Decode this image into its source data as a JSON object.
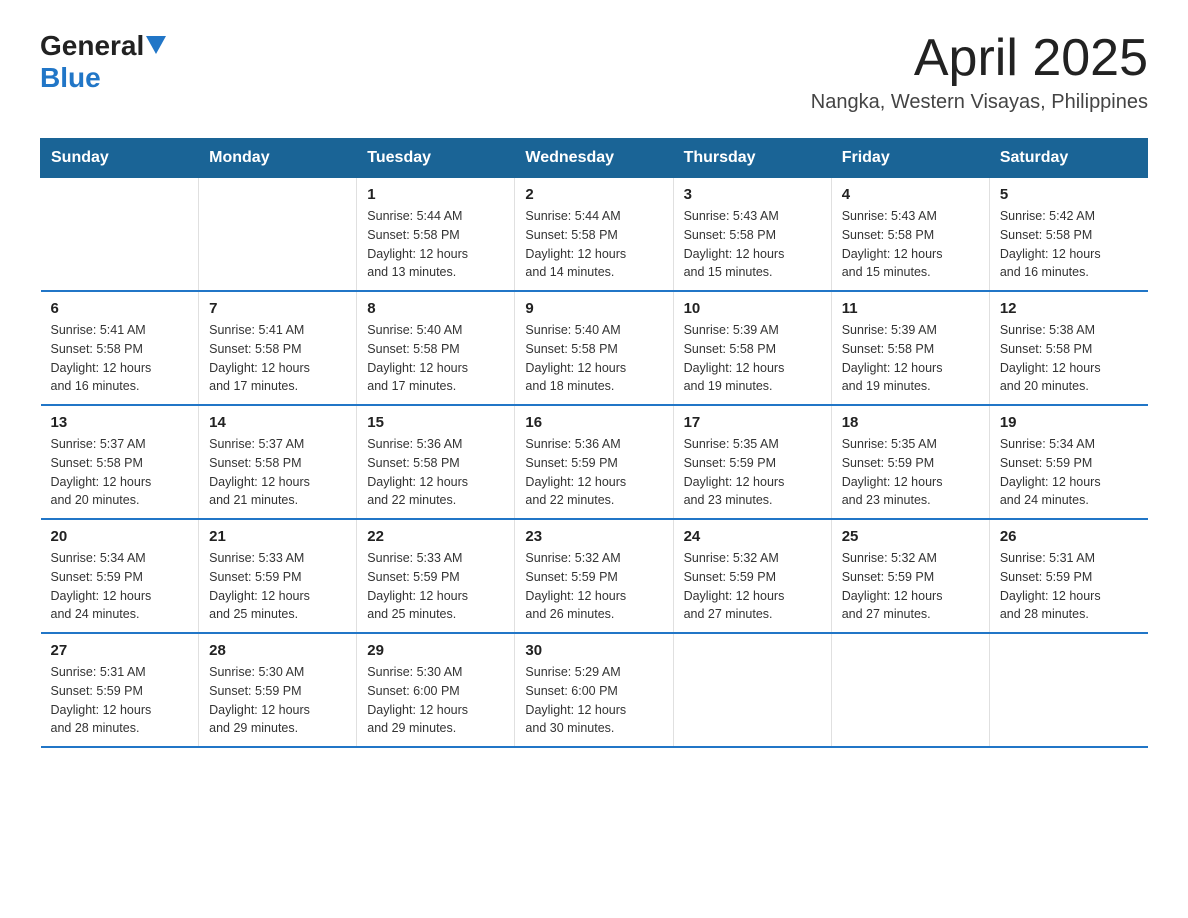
{
  "header": {
    "logo_general": "General",
    "logo_blue": "Blue",
    "month_title": "April 2025",
    "location": "Nangka, Western Visayas, Philippines"
  },
  "days_of_week": [
    "Sunday",
    "Monday",
    "Tuesday",
    "Wednesday",
    "Thursday",
    "Friday",
    "Saturday"
  ],
  "weeks": [
    [
      {
        "day": "",
        "info": ""
      },
      {
        "day": "",
        "info": ""
      },
      {
        "day": "1",
        "info": "Sunrise: 5:44 AM\nSunset: 5:58 PM\nDaylight: 12 hours\nand 13 minutes."
      },
      {
        "day": "2",
        "info": "Sunrise: 5:44 AM\nSunset: 5:58 PM\nDaylight: 12 hours\nand 14 minutes."
      },
      {
        "day": "3",
        "info": "Sunrise: 5:43 AM\nSunset: 5:58 PM\nDaylight: 12 hours\nand 15 minutes."
      },
      {
        "day": "4",
        "info": "Sunrise: 5:43 AM\nSunset: 5:58 PM\nDaylight: 12 hours\nand 15 minutes."
      },
      {
        "day": "5",
        "info": "Sunrise: 5:42 AM\nSunset: 5:58 PM\nDaylight: 12 hours\nand 16 minutes."
      }
    ],
    [
      {
        "day": "6",
        "info": "Sunrise: 5:41 AM\nSunset: 5:58 PM\nDaylight: 12 hours\nand 16 minutes."
      },
      {
        "day": "7",
        "info": "Sunrise: 5:41 AM\nSunset: 5:58 PM\nDaylight: 12 hours\nand 17 minutes."
      },
      {
        "day": "8",
        "info": "Sunrise: 5:40 AM\nSunset: 5:58 PM\nDaylight: 12 hours\nand 17 minutes."
      },
      {
        "day": "9",
        "info": "Sunrise: 5:40 AM\nSunset: 5:58 PM\nDaylight: 12 hours\nand 18 minutes."
      },
      {
        "day": "10",
        "info": "Sunrise: 5:39 AM\nSunset: 5:58 PM\nDaylight: 12 hours\nand 19 minutes."
      },
      {
        "day": "11",
        "info": "Sunrise: 5:39 AM\nSunset: 5:58 PM\nDaylight: 12 hours\nand 19 minutes."
      },
      {
        "day": "12",
        "info": "Sunrise: 5:38 AM\nSunset: 5:58 PM\nDaylight: 12 hours\nand 20 minutes."
      }
    ],
    [
      {
        "day": "13",
        "info": "Sunrise: 5:37 AM\nSunset: 5:58 PM\nDaylight: 12 hours\nand 20 minutes."
      },
      {
        "day": "14",
        "info": "Sunrise: 5:37 AM\nSunset: 5:58 PM\nDaylight: 12 hours\nand 21 minutes."
      },
      {
        "day": "15",
        "info": "Sunrise: 5:36 AM\nSunset: 5:58 PM\nDaylight: 12 hours\nand 22 minutes."
      },
      {
        "day": "16",
        "info": "Sunrise: 5:36 AM\nSunset: 5:59 PM\nDaylight: 12 hours\nand 22 minutes."
      },
      {
        "day": "17",
        "info": "Sunrise: 5:35 AM\nSunset: 5:59 PM\nDaylight: 12 hours\nand 23 minutes."
      },
      {
        "day": "18",
        "info": "Sunrise: 5:35 AM\nSunset: 5:59 PM\nDaylight: 12 hours\nand 23 minutes."
      },
      {
        "day": "19",
        "info": "Sunrise: 5:34 AM\nSunset: 5:59 PM\nDaylight: 12 hours\nand 24 minutes."
      }
    ],
    [
      {
        "day": "20",
        "info": "Sunrise: 5:34 AM\nSunset: 5:59 PM\nDaylight: 12 hours\nand 24 minutes."
      },
      {
        "day": "21",
        "info": "Sunrise: 5:33 AM\nSunset: 5:59 PM\nDaylight: 12 hours\nand 25 minutes."
      },
      {
        "day": "22",
        "info": "Sunrise: 5:33 AM\nSunset: 5:59 PM\nDaylight: 12 hours\nand 25 minutes."
      },
      {
        "day": "23",
        "info": "Sunrise: 5:32 AM\nSunset: 5:59 PM\nDaylight: 12 hours\nand 26 minutes."
      },
      {
        "day": "24",
        "info": "Sunrise: 5:32 AM\nSunset: 5:59 PM\nDaylight: 12 hours\nand 27 minutes."
      },
      {
        "day": "25",
        "info": "Sunrise: 5:32 AM\nSunset: 5:59 PM\nDaylight: 12 hours\nand 27 minutes."
      },
      {
        "day": "26",
        "info": "Sunrise: 5:31 AM\nSunset: 5:59 PM\nDaylight: 12 hours\nand 28 minutes."
      }
    ],
    [
      {
        "day": "27",
        "info": "Sunrise: 5:31 AM\nSunset: 5:59 PM\nDaylight: 12 hours\nand 28 minutes."
      },
      {
        "day": "28",
        "info": "Sunrise: 5:30 AM\nSunset: 5:59 PM\nDaylight: 12 hours\nand 29 minutes."
      },
      {
        "day": "29",
        "info": "Sunrise: 5:30 AM\nSunset: 6:00 PM\nDaylight: 12 hours\nand 29 minutes."
      },
      {
        "day": "30",
        "info": "Sunrise: 5:29 AM\nSunset: 6:00 PM\nDaylight: 12 hours\nand 30 minutes."
      },
      {
        "day": "",
        "info": ""
      },
      {
        "day": "",
        "info": ""
      },
      {
        "day": "",
        "info": ""
      }
    ]
  ]
}
